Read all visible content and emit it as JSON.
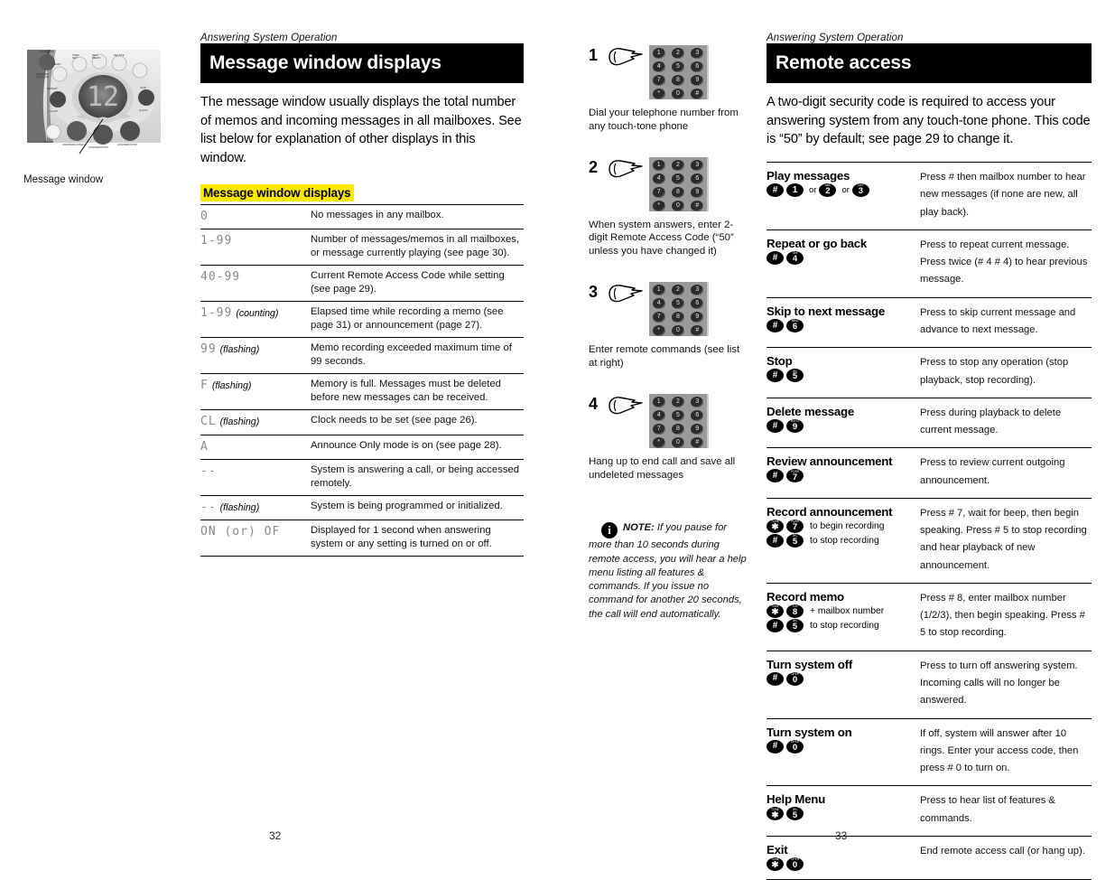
{
  "left_page": {
    "running_head": "Answering System Operation",
    "title": "Message window displays",
    "intro": "The message window usually displays the total number of memos and incoming messages in all mailboxes. See list below for explanation of other displays in this window.",
    "photo_caption": "Message window",
    "photo_display_value": "12",
    "subhead": "Message window displays",
    "page_number": "32",
    "table": {
      "rows": [
        {
          "code": "0",
          "note": "",
          "desc": "No messages in any mailbox."
        },
        {
          "code": "1-99",
          "note": "",
          "desc": "Number of messages/memos in all mailboxes, or message currently playing (see page 30)."
        },
        {
          "code": "40-99",
          "note": "",
          "desc": "Current Remote Access Code while setting (see page 29)."
        },
        {
          "code": "1-99",
          "note": "(counting)",
          "desc": "Elapsed time while recording a memo (see page 31) or announcement (page 27)."
        },
        {
          "code": "99",
          "note": "(flashing)",
          "desc": "Memo recording exceeded maximum time of 99 seconds."
        },
        {
          "code": "F",
          "note": "(flashing)",
          "desc": "Memory is full. Messages must be deleted before new messages can be received."
        },
        {
          "code": "CL",
          "note": "(flashing)",
          "desc": "Clock needs to be set (see page 26)."
        },
        {
          "code": "A",
          "note": "",
          "desc": "Announce Only mode is on (see page 28)."
        },
        {
          "code": "--",
          "note": "",
          "desc": "System is answering a call, or being accessed remotely."
        },
        {
          "code": "--",
          "note": "(flashing)",
          "desc": "System is being programmed or initialized."
        },
        {
          "code": "ON (or) OF",
          "note": "",
          "desc": "Displayed for 1 second when answering system or any setting is turned on or off."
        }
      ]
    }
  },
  "middle_column": {
    "steps": [
      {
        "num": "1",
        "text": "Dial your telephone number from any touch-tone phone"
      },
      {
        "num": "2",
        "text": "When system answers, enter 2-digit Remote Access Code (“50” unless you have changed it)"
      },
      {
        "num": "3",
        "text": "Enter remote commands (see list at right)"
      },
      {
        "num": "4",
        "text": "Hang up to end call and save all undeleted messages"
      }
    ],
    "keypad_keys": [
      "1",
      "2",
      "3",
      "4",
      "5",
      "6",
      "7",
      "8",
      "9",
      "*",
      "0",
      "#"
    ],
    "note_label": "NOTE:",
    "note_text": " If you pause for more than 10 seconds during remote access, you will hear a help menu listing all features & commands. If you issue no command for another 20 seconds, the call will end automatically."
  },
  "right_page": {
    "running_head": "Answering System Operation",
    "title": "Remote access",
    "intro": "A two-digit security code is required to access your answering system from any touch-tone phone. This code is “50” by default; see page 29 to change it.",
    "page_number": "33",
    "commands": [
      {
        "title": "Play messages",
        "keys": [
          {
            "type": "seq",
            "buttons": [
              {
                "letters": "",
                "digit": "#"
              },
              {
                "letters": "",
                "digit": "1"
              }
            ]
          },
          {
            "type": "sep",
            "label": "or"
          },
          {
            "type": "seq",
            "buttons": [
              {
                "letters": "ABC",
                "digit": "2"
              }
            ]
          },
          {
            "type": "sep",
            "label": "or"
          },
          {
            "type": "seq",
            "buttons": [
              {
                "letters": "DEF",
                "digit": "3"
              }
            ]
          }
        ],
        "desc": "Press # then mailbox number to hear new messages (if none are new, all play back)."
      },
      {
        "title": "Repeat or go back",
        "keys": [
          {
            "type": "seq",
            "buttons": [
              {
                "letters": "",
                "digit": "#"
              },
              {
                "letters": "GHI",
                "digit": "4"
              }
            ]
          }
        ],
        "desc": "Press to repeat current message. Press twice (# 4 # 4) to hear previous message."
      },
      {
        "title": "Skip to next message",
        "keys": [
          {
            "type": "seq",
            "buttons": [
              {
                "letters": "",
                "digit": "#"
              },
              {
                "letters": "MNO",
                "digit": "6"
              }
            ]
          }
        ],
        "desc": "Press to skip current message and advance to next message."
      },
      {
        "title": "Stop",
        "keys": [
          {
            "type": "seq",
            "buttons": [
              {
                "letters": "",
                "digit": "#"
              },
              {
                "letters": "JKL",
                "digit": "5"
              }
            ]
          }
        ],
        "desc": "Press to stop any operation (stop playback, stop recording)."
      },
      {
        "title": "Delete message",
        "keys": [
          {
            "type": "seq",
            "buttons": [
              {
                "letters": "",
                "digit": "#"
              },
              {
                "letters": "WXYZ",
                "digit": "9"
              }
            ]
          }
        ],
        "desc": "Press during playback to delete current message."
      },
      {
        "title": "Review announcement",
        "keys": [
          {
            "type": "seq",
            "buttons": [
              {
                "letters": "",
                "digit": "#"
              },
              {
                "letters": "PQRS",
                "digit": "7"
              }
            ]
          }
        ],
        "desc": "Press to review current outgoing announcement."
      },
      {
        "title": "Record announcement",
        "keys": [
          {
            "type": "seq",
            "buttons": [
              {
                "letters": "TONE",
                "digit": "✱"
              },
              {
                "letters": "PQRS",
                "digit": "7"
              }
            ],
            "after": "to begin recording"
          },
          {
            "type": "seq",
            "buttons": [
              {
                "letters": "",
                "digit": "#"
              },
              {
                "letters": "JKL",
                "digit": "5"
              }
            ],
            "after": "to stop recording"
          }
        ],
        "desc": "Press # 7, wait for beep, then begin speaking. Press # 5 to stop recording and hear playback of new announcement."
      },
      {
        "title": "Record memo",
        "keys": [
          {
            "type": "seq",
            "buttons": [
              {
                "letters": "TONE",
                "digit": "✱"
              },
              {
                "letters": "TUV",
                "digit": "8"
              }
            ],
            "after": "+ mailbox number"
          },
          {
            "type": "seq",
            "buttons": [
              {
                "letters": "",
                "digit": "#"
              },
              {
                "letters": "JKL",
                "digit": "5"
              }
            ],
            "after": "to stop recording"
          }
        ],
        "desc": "Press # 8, enter mailbox number (1/2/3), then begin speaking. Press # 5 to stop recording."
      },
      {
        "title": "Turn system off",
        "keys": [
          {
            "type": "seq",
            "buttons": [
              {
                "letters": "",
                "digit": "#"
              },
              {
                "letters": "OPER",
                "digit": "0"
              }
            ]
          }
        ],
        "desc": "Press to turn off answering system. Incoming calls will no longer be answered."
      },
      {
        "title": "Turn system on",
        "keys": [
          {
            "type": "seq",
            "buttons": [
              {
                "letters": "",
                "digit": "#"
              },
              {
                "letters": "OPER",
                "digit": "0"
              }
            ]
          }
        ],
        "desc": "If off, system will answer after 10 rings. Enter your access code, then press # 0 to turn on."
      },
      {
        "title": "Help Menu",
        "keys": [
          {
            "type": "seq",
            "buttons": [
              {
                "letters": "TONE",
                "digit": "✱"
              },
              {
                "letters": "JKL",
                "digit": "5"
              }
            ]
          }
        ],
        "desc": "Press to hear list of features & commands."
      },
      {
        "title": "Exit",
        "keys": [
          {
            "type": "seq",
            "buttons": [
              {
                "letters": "TONE",
                "digit": "✱"
              },
              {
                "letters": "OPER",
                "digit": "0"
              }
            ]
          }
        ],
        "desc": "End remote access call (or hang up)."
      }
    ]
  }
}
